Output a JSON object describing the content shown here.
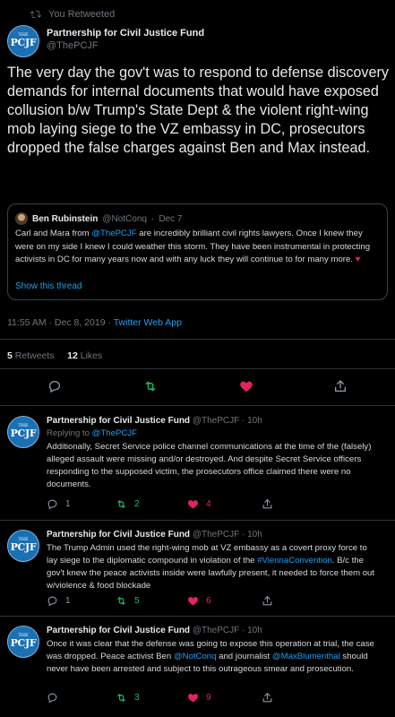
{
  "retweet": {
    "label": "You Retweeted"
  },
  "main": {
    "name": "Partnership for Civil Justice Fund",
    "handle": "@ThePCJF",
    "avatar": {
      "the": "THE",
      "abbr": "PCJF"
    },
    "text": "The very day the gov't was to respond to defense discovery demands for internal documents that would have exposed collusion b/w Trump's State Dept & the violent right-wing mob laying siege to the VZ embassy in DC, prosecutors dropped the false charges against Ben and Max instead.",
    "quote": {
      "name": "Ben Rubinstein",
      "handle": "@NotConq",
      "date": "Dec 7",
      "text_a": "Carl and Mara from ",
      "text_mention": "@ThePCJF",
      "text_b": " are  incredibly brilliant civil rights lawyers. Once I knew they were on my side I knew I could weather this storm. They have been instrumental in protecting activists in DC for many years now and with any luck they will continue to for many more. ",
      "heart": "♥",
      "show_thread": "Show this thread"
    },
    "timestamp": "11:55 AM · Dec 8, 2019 · ",
    "source": "Twitter Web App",
    "stats": {
      "retweets_count": "5",
      "retweets_label": "Retweets",
      "likes_count": "12",
      "likes_label": "Likes"
    }
  },
  "replies": [
    {
      "name": "Partnership for Civil Justice Fund",
      "handle": "@ThePCJF · 10h",
      "replying_label": "Replying to ",
      "replying_to": "@ThePCJF",
      "text": "Additionally, Secret Service police channel communications at the time of the (falsely) alleged assault were missing and/or destroyed. And despite Secret Service officers responding to the supposed victim, the prosecutors office claimed there were no documents.",
      "replies": "1",
      "retweets": "2",
      "likes": "4"
    },
    {
      "name": "Partnership for Civil Justice Fund",
      "handle": "@ThePCJF · 10h",
      "text_a": "The Trump Admin used the right-wing mob at VZ embassy as a covert proxy force to lay siege to the diplomatic compound in violation of the ",
      "hashtag": "#ViennaConvention",
      "text_b": ". B/c the gov't knew the peace activists inside were lawfully present, it needed to force them out w/violence & food blockade",
      "replies": "1",
      "retweets": "5",
      "likes": "6"
    },
    {
      "name": "Partnership for Civil Justice Fund",
      "handle": "@ThePCJF · 10h",
      "text_a": "Once it was clear that the defense was going to expose this operation at trial, the case was dropped. Peace activist Ben ",
      "mention1": "@NotConq",
      "text_b": " and journalist ",
      "mention2": "@MaxBlumenthal",
      "text_c": " should never have been arrested and subject to this outrageous smear and prosecution.",
      "replies": "",
      "retweets": "3",
      "likes": "9"
    }
  ],
  "colors": {
    "accent": "#1da1f2",
    "like": "#e0245e",
    "retweet": "#17bf63",
    "background": "#000000"
  }
}
